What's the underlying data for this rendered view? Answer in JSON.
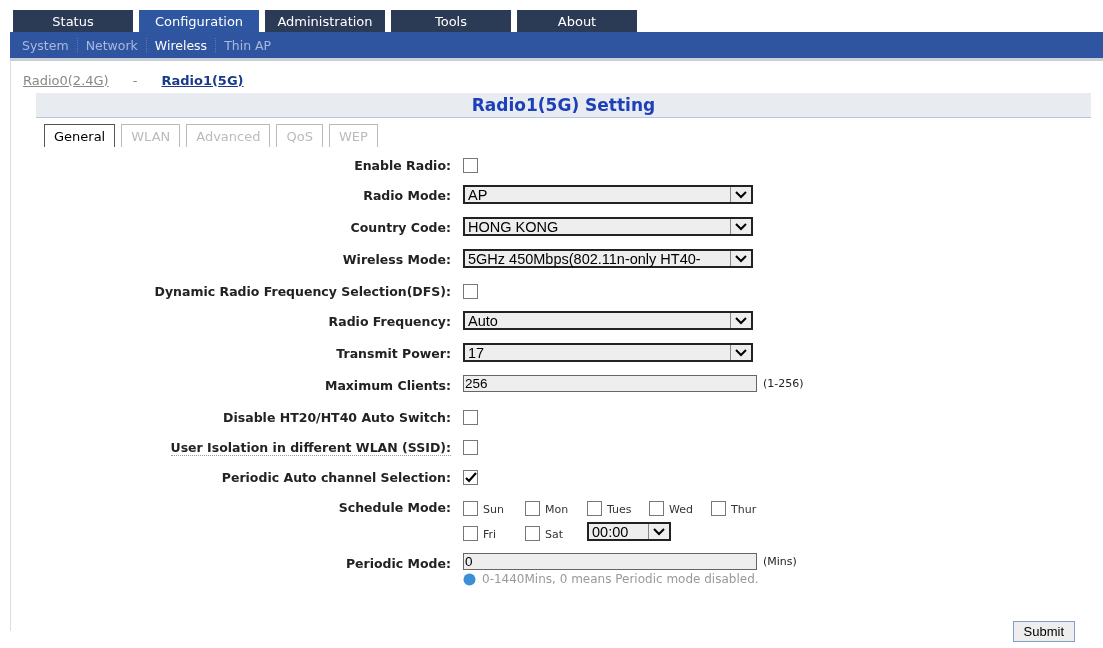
{
  "main_tabs": [
    {
      "label": "Status",
      "selected": false
    },
    {
      "label": "Configuration",
      "selected": true
    },
    {
      "label": "Administration",
      "selected": false
    },
    {
      "label": "Tools",
      "selected": false
    },
    {
      "label": "About",
      "selected": false
    }
  ],
  "sub_nav": [
    {
      "label": "System",
      "selected": false
    },
    {
      "label": "Network",
      "selected": false
    },
    {
      "label": "Wireless",
      "selected": true
    },
    {
      "label": "Thin AP",
      "selected": false
    }
  ],
  "radio_links": [
    {
      "label": "Radio0(2.4G)",
      "selected": false
    },
    {
      "label": "Radio1(5G)",
      "selected": true
    }
  ],
  "radio_separator": "-",
  "heading": "Radio1(5G) Setting",
  "section_tabs": [
    {
      "label": "General",
      "selected": true
    },
    {
      "label": "WLAN",
      "selected": false
    },
    {
      "label": "Advanced",
      "selected": false
    },
    {
      "label": "QoS",
      "selected": false
    },
    {
      "label": "WEP",
      "selected": false
    }
  ],
  "fields": [
    {
      "kind": "checkbox",
      "label": "Enable Radio:",
      "checked": false
    },
    {
      "kind": "select",
      "label": "Radio Mode:",
      "value": "AP"
    },
    {
      "kind": "select",
      "label": "Country Code:",
      "value": "HONG KONG"
    },
    {
      "kind": "select",
      "label": "Wireless Mode:",
      "value": "5GHz 450Mbps(802.11n-only HT40-"
    },
    {
      "kind": "checkbox",
      "label": "Dynamic Radio Frequency Selection(DFS):",
      "checked": false
    },
    {
      "kind": "select",
      "label": "Radio Frequency:",
      "value": "Auto"
    },
    {
      "kind": "select",
      "label": "Transmit Power:",
      "value": "17"
    },
    {
      "kind": "text",
      "label": "Maximum Clients:",
      "value": "256",
      "suffix": "(1-256)"
    },
    {
      "kind": "checkbox",
      "label": "Disable HT20/HT40 Auto Switch:",
      "checked": false
    },
    {
      "kind": "checkbox",
      "label": "User Isolation in different WLAN (SSID):",
      "checked": false,
      "has_tooltip": true
    },
    {
      "kind": "checkbox",
      "label": "Periodic Auto channel Selection:",
      "checked": true
    },
    {
      "kind": "schedule",
      "label": "Schedule Mode:",
      "days": [
        {
          "label": "Sun",
          "checked": false
        },
        {
          "label": "Mon",
          "checked": false
        },
        {
          "label": "Tues",
          "checked": false
        },
        {
          "label": "Wed",
          "checked": false
        },
        {
          "label": "Thur",
          "checked": false
        },
        {
          "label": "Fri",
          "checked": false
        },
        {
          "label": "Sat",
          "checked": false
        }
      ],
      "time": "00:00"
    },
    {
      "kind": "text",
      "label": "Periodic Mode:",
      "value": "0",
      "suffix": "(Mins)",
      "hint": "0-1440Mins, 0 means Periodic mode disabled."
    }
  ],
  "submit": "Submit"
}
